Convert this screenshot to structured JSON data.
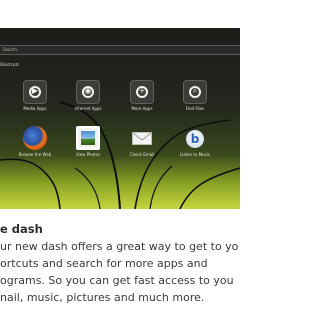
{
  "dash": {
    "search_placeholder": "Search",
    "filter_label": "Shortcuts",
    "categories": [
      {
        "label": "Media Apps",
        "icon": "play-icon"
      },
      {
        "label": "Internet Apps",
        "icon": "globe-icon"
      },
      {
        "label": "More Apps",
        "icon": "plus-icon"
      },
      {
        "label": "Find Files",
        "icon": "folder-search-icon"
      }
    ],
    "apps": [
      {
        "label": "Browse the Web",
        "icon": "firefox-icon"
      },
      {
        "label": "View Photos",
        "icon": "photos-icon"
      },
      {
        "label": "Check Email",
        "icon": "email-icon"
      },
      {
        "label": "Listen to Music",
        "icon": "music-icon"
      }
    ]
  },
  "article": {
    "heading": "e dash",
    "paragraph_lines": [
      "ur new dash offers a great way to get to yo",
      "ortcuts and search for more apps and",
      "ograms. So you can get fast access to you",
      "nail, music, pictures and much more."
    ]
  },
  "colors": {
    "accent_green": "#b5cc2f",
    "dash_background": "#1e201c"
  }
}
